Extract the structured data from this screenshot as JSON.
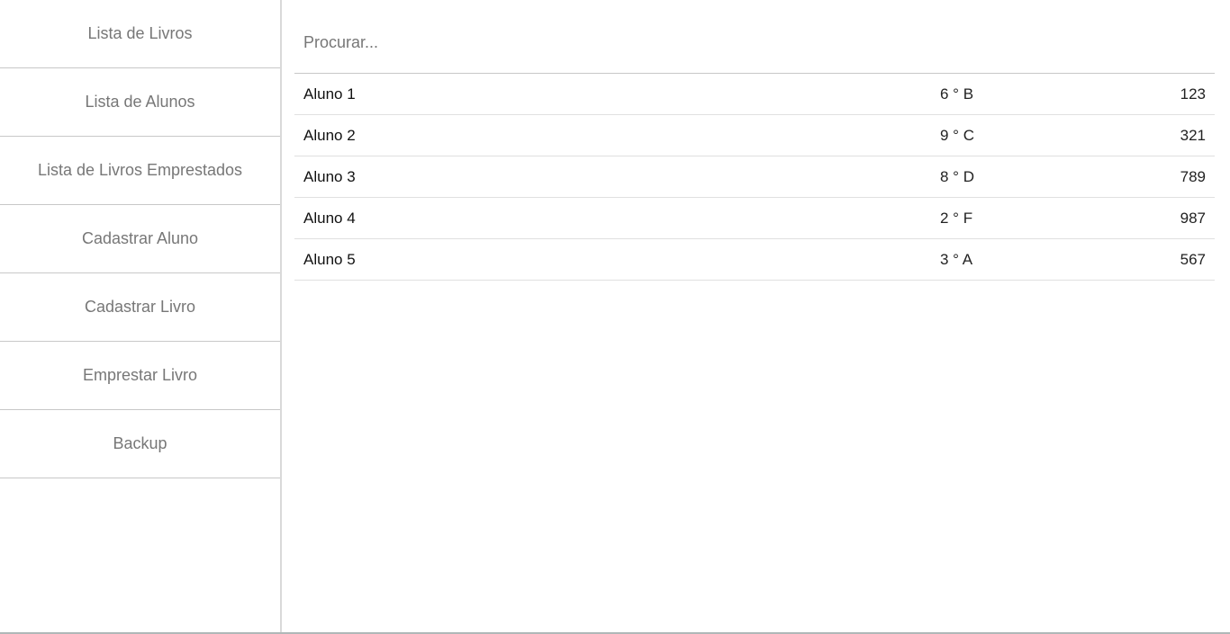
{
  "sidebar": {
    "items": [
      {
        "label": "Lista de Livros"
      },
      {
        "label": "Lista de Alunos"
      },
      {
        "label": "Lista de Livros Emprestados"
      },
      {
        "label": "Cadastrar Aluno"
      },
      {
        "label": "Cadastrar Livro"
      },
      {
        "label": "Emprestar Livro"
      },
      {
        "label": "Backup"
      }
    ]
  },
  "search": {
    "placeholder": "Procurar...",
    "value": ""
  },
  "students": [
    {
      "name": "Aluno 1",
      "class": "6 ° B",
      "id": "123"
    },
    {
      "name": "Aluno 2",
      "class": "9 ° C",
      "id": "321"
    },
    {
      "name": "Aluno 3",
      "class": "8 ° D",
      "id": "789"
    },
    {
      "name": "Aluno 4",
      "class": "2 ° F",
      "id": "987"
    },
    {
      "name": "Aluno 5",
      "class": "3 ° A",
      "id": "567"
    }
  ]
}
